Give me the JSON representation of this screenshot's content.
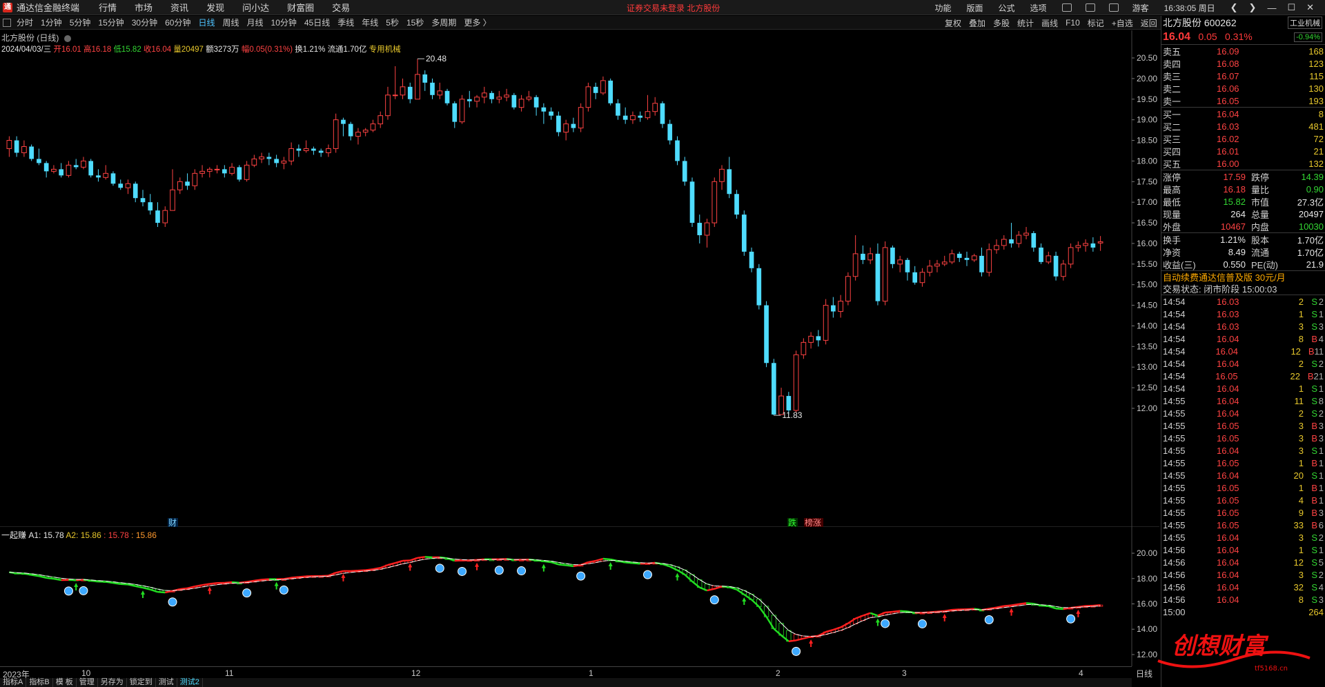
{
  "titlebar": {
    "app": "通达信金融终端",
    "menus": [
      "行情",
      "市场",
      "资讯",
      "发现",
      "问小达",
      "财富圈",
      "交易"
    ],
    "alert": "证券交易未登录  北方股份",
    "right_items": [
      "功能",
      "版面",
      "公式",
      "选项"
    ],
    "user": "游客",
    "time": "16:38:05 周日"
  },
  "periods": [
    "分时",
    "1分钟",
    "5分钟",
    "15分钟",
    "30分钟",
    "60分钟",
    "日线",
    "周线",
    "月线",
    "10分钟",
    "45日线",
    "季线",
    "年线",
    "5秒",
    "15秒",
    "多周期",
    "更多 〉"
  ],
  "active_period": "日线",
  "right_tools": [
    "复权",
    "叠加",
    "多股",
    "统计",
    "画线",
    "F10",
    "标记",
    "+自选",
    "返回"
  ],
  "chart_header": {
    "title": "北方股份 (日线)",
    "date": "2024/04/03/三",
    "open": "开16.01",
    "high": "高16.18",
    "low": "低15.82",
    "close": "收16.04",
    "volume": "量20497",
    "amount": "额3273万",
    "change": "幅0.05(0.31%)",
    "turnover": "换1.21%",
    "float_cap": "流通1.70亿",
    "sector": "专用机械"
  },
  "chart_data": {
    "type": "candlestick",
    "y_ticks": [
      "20.50",
      "20.00",
      "19.50",
      "19.00",
      "18.50",
      "18.00",
      "17.50",
      "17.00",
      "16.50",
      "16.00",
      "15.50",
      "15.00",
      "14.50",
      "14.00",
      "13.50",
      "13.00",
      "12.50",
      "12.00"
    ],
    "ylim": [
      11.75,
      20.75
    ],
    "high_marker": "20.48",
    "low_marker": "11.83",
    "candles": [
      [
        18.3,
        18.5,
        18.6,
        18.1
      ],
      [
        18.5,
        18.2,
        18.6,
        18.1
      ],
      [
        18.2,
        18.35,
        18.5,
        18.1
      ],
      [
        18.35,
        18.05,
        18.4,
        18.0
      ],
      [
        18.05,
        17.95,
        18.3,
        17.9
      ],
      [
        17.95,
        17.75,
        18.0,
        17.6
      ],
      [
        17.75,
        17.8,
        17.9,
        17.7
      ],
      [
        17.8,
        17.65,
        17.95,
        17.6
      ],
      [
        17.65,
        17.9,
        18.0,
        17.6
      ],
      [
        17.9,
        17.85,
        18.05,
        17.8
      ],
      [
        17.85,
        18.0,
        18.1,
        17.8
      ],
      [
        18.0,
        17.65,
        18.05,
        17.6
      ],
      [
        17.65,
        17.6,
        17.8,
        17.5
      ],
      [
        17.6,
        17.7,
        17.9,
        17.55
      ],
      [
        17.7,
        17.45,
        17.75,
        17.4
      ],
      [
        17.45,
        17.35,
        17.55,
        17.3
      ],
      [
        17.35,
        17.45,
        17.55,
        17.2
      ],
      [
        17.45,
        17.1,
        17.5,
        17.0
      ],
      [
        17.1,
        17.0,
        17.3,
        16.9
      ],
      [
        17.0,
        16.8,
        17.2,
        16.7
      ],
      [
        16.8,
        16.5,
        17.0,
        16.4
      ],
      [
        16.5,
        16.8,
        16.9,
        16.4
      ],
      [
        16.8,
        17.3,
        17.8,
        16.8
      ],
      [
        17.3,
        17.5,
        17.6,
        17.2
      ],
      [
        17.5,
        17.4,
        17.7,
        17.3
      ],
      [
        17.4,
        17.7,
        17.8,
        17.3
      ],
      [
        17.7,
        17.75,
        17.9,
        17.6
      ],
      [
        17.75,
        17.8,
        17.85,
        17.6
      ],
      [
        17.8,
        17.8,
        17.9,
        17.7
      ],
      [
        17.8,
        17.7,
        17.9,
        17.6
      ],
      [
        17.7,
        17.85,
        17.95,
        17.65
      ],
      [
        17.85,
        17.55,
        17.9,
        17.5
      ],
      [
        17.55,
        17.9,
        18.0,
        17.5
      ],
      [
        17.9,
        18.05,
        18.15,
        17.85
      ],
      [
        18.05,
        18.1,
        18.2,
        17.95
      ],
      [
        18.1,
        18.05,
        18.2,
        17.9
      ],
      [
        18.05,
        17.95,
        18.15,
        17.85
      ],
      [
        17.95,
        18.0,
        18.1,
        17.8
      ],
      [
        18.0,
        18.3,
        18.45,
        17.9
      ],
      [
        18.3,
        18.25,
        18.4,
        18.1
      ],
      [
        18.25,
        18.3,
        18.5,
        18.2
      ],
      [
        18.3,
        18.25,
        18.35,
        18.15
      ],
      [
        18.25,
        18.2,
        18.3,
        18.1
      ],
      [
        18.2,
        18.3,
        18.4,
        18.1
      ],
      [
        18.3,
        19.0,
        19.15,
        18.2
      ],
      [
        19.0,
        18.9,
        19.05,
        18.6
      ],
      [
        18.9,
        18.6,
        18.95,
        18.5
      ],
      [
        18.6,
        18.7,
        18.8,
        18.4
      ],
      [
        18.7,
        18.75,
        18.8,
        18.6
      ],
      [
        18.75,
        18.9,
        19.0,
        18.7
      ],
      [
        18.9,
        19.1,
        19.2,
        18.8
      ],
      [
        19.1,
        19.6,
        19.8,
        19.0
      ],
      [
        19.6,
        19.6,
        20.3,
        19.5
      ],
      [
        19.6,
        19.8,
        20.0,
        19.5
      ],
      [
        19.8,
        19.5,
        19.9,
        19.4
      ],
      [
        19.5,
        20.1,
        20.48,
        19.5
      ],
      [
        20.1,
        19.9,
        20.2,
        19.7
      ],
      [
        19.9,
        19.6,
        20.0,
        19.5
      ],
      [
        19.6,
        19.7,
        19.9,
        19.5
      ],
      [
        19.7,
        19.4,
        19.75,
        19.35
      ],
      [
        19.4,
        18.95,
        19.45,
        18.8
      ],
      [
        18.95,
        19.5,
        19.6,
        18.9
      ],
      [
        19.5,
        19.45,
        19.7,
        19.3
      ],
      [
        19.45,
        19.55,
        19.6,
        19.3
      ],
      [
        19.55,
        19.65,
        19.8,
        19.4
      ],
      [
        19.65,
        19.5,
        19.7,
        19.4
      ],
      [
        19.5,
        19.55,
        19.7,
        19.4
      ],
      [
        19.55,
        19.6,
        19.75,
        19.45
      ],
      [
        19.6,
        19.3,
        19.65,
        19.25
      ],
      [
        19.3,
        19.5,
        19.6,
        19.2
      ],
      [
        19.5,
        19.55,
        19.7,
        19.45
      ],
      [
        19.55,
        19.3,
        19.6,
        19.1
      ],
      [
        19.3,
        19.2,
        19.4,
        18.9
      ],
      [
        19.2,
        19.1,
        19.3,
        19.0
      ],
      [
        19.1,
        18.7,
        19.2,
        18.6
      ],
      [
        18.7,
        18.9,
        19.0,
        18.5
      ],
      [
        18.9,
        18.8,
        19.05,
        18.7
      ],
      [
        18.8,
        19.3,
        19.4,
        18.7
      ],
      [
        19.3,
        19.8,
        19.9,
        19.2
      ],
      [
        19.8,
        19.65,
        19.9,
        19.5
      ],
      [
        19.65,
        19.95,
        20.05,
        19.6
      ],
      [
        19.95,
        19.4,
        20.0,
        19.35
      ],
      [
        19.4,
        19.1,
        19.5,
        19.0
      ],
      [
        19.1,
        19.0,
        19.3,
        18.9
      ],
      [
        19.0,
        19.1,
        19.2,
        18.9
      ],
      [
        19.1,
        19.05,
        19.2,
        18.95
      ],
      [
        19.05,
        19.2,
        19.6,
        19.0
      ],
      [
        19.2,
        19.4,
        19.55,
        19.1
      ],
      [
        19.4,
        18.9,
        19.45,
        18.8
      ],
      [
        18.9,
        18.5,
        19.0,
        18.4
      ],
      [
        18.5,
        18.0,
        18.6,
        17.9
      ],
      [
        18.0,
        17.5,
        18.1,
        17.4
      ],
      [
        17.5,
        16.5,
        17.6,
        16.4
      ],
      [
        16.5,
        16.2,
        16.7,
        16.0
      ],
      [
        16.2,
        16.5,
        16.6,
        15.9
      ],
      [
        16.5,
        17.5,
        17.6,
        16.4
      ],
      [
        17.5,
        17.8,
        17.9,
        17.3
      ],
      [
        17.8,
        17.2,
        18.1,
        17.1
      ],
      [
        17.2,
        16.7,
        17.3,
        16.6
      ],
      [
        16.7,
        15.8,
        16.8,
        15.7
      ],
      [
        15.8,
        15.4,
        15.9,
        15.3
      ],
      [
        15.4,
        14.5,
        15.5,
        14.4
      ],
      [
        14.5,
        13.1,
        14.6,
        13.0
      ],
      [
        13.1,
        11.85,
        13.2,
        11.83
      ],
      [
        11.85,
        12.3,
        12.5,
        11.9
      ],
      [
        12.3,
        11.95,
        12.4,
        11.85
      ],
      [
        11.95,
        13.3,
        13.4,
        11.9
      ],
      [
        13.3,
        13.6,
        13.7,
        13.2
      ],
      [
        13.6,
        13.75,
        13.85,
        13.45
      ],
      [
        13.75,
        13.65,
        13.9,
        13.5
      ],
      [
        13.65,
        14.5,
        14.65,
        13.55
      ],
      [
        14.5,
        14.35,
        14.7,
        14.2
      ],
      [
        14.35,
        14.6,
        14.75,
        14.2
      ],
      [
        14.6,
        15.2,
        15.3,
        14.5
      ],
      [
        15.2,
        15.75,
        16.2,
        15.1
      ],
      [
        15.75,
        15.6,
        15.95,
        15.5
      ],
      [
        15.6,
        15.75,
        15.9,
        15.5
      ],
      [
        15.75,
        14.6,
        16.0,
        14.5
      ],
      [
        14.6,
        15.9,
        16.05,
        14.5
      ],
      [
        15.9,
        15.5,
        15.95,
        15.4
      ],
      [
        15.5,
        15.6,
        15.7,
        15.3
      ],
      [
        15.6,
        15.3,
        15.65,
        15.1
      ],
      [
        15.3,
        15.05,
        15.45,
        15.0
      ],
      [
        15.05,
        15.3,
        15.4,
        14.95
      ],
      [
        15.3,
        15.45,
        15.6,
        15.2
      ],
      [
        15.45,
        15.5,
        15.6,
        15.3
      ],
      [
        15.5,
        15.55,
        15.7,
        15.45
      ],
      [
        15.55,
        15.75,
        15.85,
        15.5
      ],
      [
        15.75,
        15.65,
        15.8,
        15.55
      ],
      [
        15.65,
        15.6,
        15.8,
        15.45
      ],
      [
        15.6,
        15.7,
        15.75,
        15.55
      ],
      [
        15.7,
        15.3,
        15.9,
        15.2
      ],
      [
        15.3,
        15.85,
        16.0,
        15.2
      ],
      [
        15.85,
        15.95,
        16.1,
        15.75
      ],
      [
        15.95,
        16.1,
        16.2,
        15.85
      ],
      [
        16.1,
        16.0,
        16.5,
        15.9
      ],
      [
        16.0,
        16.2,
        16.3,
        15.9
      ],
      [
        16.2,
        16.25,
        16.4,
        16.1
      ],
      [
        16.25,
        15.9,
        16.3,
        15.8
      ],
      [
        15.9,
        15.55,
        16.0,
        15.5
      ],
      [
        15.55,
        15.7,
        15.8,
        15.5
      ],
      [
        15.7,
        15.2,
        15.8,
        15.1
      ],
      [
        15.2,
        15.5,
        15.6,
        15.1
      ],
      [
        15.5,
        15.9,
        16.0,
        15.4
      ],
      [
        15.9,
        15.95,
        16.05,
        15.8
      ],
      [
        15.95,
        16.0,
        16.1,
        15.8
      ],
      [
        16.0,
        15.9,
        16.15,
        15.8
      ],
      [
        16.01,
        16.04,
        16.18,
        15.82
      ]
    ],
    "markers": {
      "cai": "财",
      "die": "跌",
      "bang": "榜涨"
    }
  },
  "indicator": {
    "name": "一起赚",
    "a1": "A1: 15.78",
    "a2": "A2: 15.86",
    "a3": ": 15.78",
    "a4": ": 15.86",
    "y_ticks": [
      "20.00",
      "18.00",
      "16.00",
      "14.00",
      "12.00"
    ],
    "ylim": [
      11.3,
      21.5
    ]
  },
  "xaxis": [
    "2023年",
    "10",
    "11",
    "12",
    "1",
    "2",
    "3",
    "4"
  ],
  "bottom_tabs": [
    "指标A",
    "指标B",
    "模 板",
    "管理",
    "另存为",
    "锁定到",
    "测试",
    "测试2"
  ],
  "active_tab": "测试2",
  "day_button": "日线",
  "quote": {
    "name": "北方股份  600262",
    "industry": "工业机械",
    "price": "16.04",
    "change": "0.05",
    "pct": "0.31%",
    "industry_pct": "-0.94%",
    "asks": [
      {
        "label": "卖五",
        "price": "16.09",
        "vol": "168"
      },
      {
        "label": "卖四",
        "price": "16.08",
        "vol": "123"
      },
      {
        "label": "卖三",
        "price": "16.07",
        "vol": "115"
      },
      {
        "label": "卖二",
        "price": "16.06",
        "vol": "130"
      },
      {
        "label": "卖一",
        "price": "16.05",
        "vol": "193"
      }
    ],
    "bids": [
      {
        "label": "买一",
        "price": "16.04",
        "vol": "8"
      },
      {
        "label": "买二",
        "price": "16.03",
        "vol": "481"
      },
      {
        "label": "买三",
        "price": "16.02",
        "vol": "72"
      },
      {
        "label": "买四",
        "price": "16.01",
        "vol": "21"
      },
      {
        "label": "买五",
        "price": "16.00",
        "vol": "132"
      }
    ],
    "stats1": [
      {
        "a": "涨停",
        "av": "17.59",
        "ac": "red",
        "b": "跌停",
        "bv": "14.39",
        "bc": "green"
      },
      {
        "a": "最高",
        "av": "16.18",
        "ac": "red",
        "b": "量比",
        "bv": "0.90",
        "bc": "green"
      },
      {
        "a": "最低",
        "av": "15.82",
        "ac": "green",
        "b": "市值",
        "bv": "27.3亿",
        "bc": "white"
      },
      {
        "a": "现量",
        "av": "264",
        "ac": "white",
        "b": "总量",
        "bv": "20497",
        "bc": "white"
      },
      {
        "a": "外盘",
        "av": "10467",
        "ac": "red",
        "b": "内盘",
        "bv": "10030",
        "bc": "green"
      }
    ],
    "stats2": [
      {
        "a": "换手",
        "av": "1.21%",
        "ac": "white",
        "b": "股本",
        "bv": "1.70亿",
        "bc": "white"
      },
      {
        "a": "净资",
        "av": "8.49",
        "ac": "white",
        "b": "流通",
        "bv": "1.70亿",
        "bc": "white"
      },
      {
        "a": "收益(三)",
        "av": "0.550",
        "ac": "white",
        "b": "PE(动)",
        "bv": "21.9",
        "bc": "white"
      }
    ],
    "promo": "自动续费通达信普及版  30元/月",
    "trade_status": "交易状态: 闭市阶段 15:00:03",
    "ticks": [
      [
        "14:54",
        "16.03",
        "2",
        "S",
        "2"
      ],
      [
        "14:54",
        "16.03",
        "1",
        "S",
        "1"
      ],
      [
        "14:54",
        "16.03",
        "3",
        "S",
        "3"
      ],
      [
        "14:54",
        "16.04",
        "8",
        "B",
        "4"
      ],
      [
        "14:54",
        "16.04",
        "12",
        "B",
        "11"
      ],
      [
        "14:54",
        "16.04",
        "2",
        "S",
        "2"
      ],
      [
        "14:54",
        "16.05",
        "22",
        "B",
        "21"
      ],
      [
        "14:54",
        "16.04",
        "1",
        "S",
        "1"
      ],
      [
        "14:55",
        "16.04",
        "11",
        "S",
        "8"
      ],
      [
        "14:55",
        "16.04",
        "2",
        "S",
        "2"
      ],
      [
        "14:55",
        "16.05",
        "3",
        "B",
        "3"
      ],
      [
        "14:55",
        "16.05",
        "3",
        "B",
        "3"
      ],
      [
        "14:55",
        "16.04",
        "3",
        "S",
        "1"
      ],
      [
        "14:55",
        "16.05",
        "1",
        "B",
        "1"
      ],
      [
        "14:55",
        "16.04",
        "20",
        "S",
        "1"
      ],
      [
        "14:55",
        "16.05",
        "1",
        "B",
        "1"
      ],
      [
        "14:55",
        "16.05",
        "4",
        "B",
        "1"
      ],
      [
        "14:55",
        "16.05",
        "9",
        "B",
        "3"
      ],
      [
        "14:55",
        "16.05",
        "33",
        "B",
        "6"
      ],
      [
        "14:55",
        "16.04",
        "3",
        "S",
        "2"
      ],
      [
        "14:56",
        "16.04",
        "1",
        "S",
        "1"
      ],
      [
        "14:56",
        "16.04",
        "12",
        "S",
        "5"
      ],
      [
        "14:56",
        "16.04",
        "3",
        "S",
        "2"
      ],
      [
        "14:56",
        "16.04",
        "32",
        "S",
        "4"
      ],
      [
        "14:56",
        "16.04",
        "8",
        "S",
        "3"
      ]
    ],
    "close_tick": [
      "15:00",
      "264"
    ]
  },
  "watermark": {
    "text": "创想财富",
    "site": "tf5168.cn"
  },
  "colors": {
    "up": "#ff4343",
    "down": "#4fdcff",
    "ind_up": "#ff2020",
    "ind_down": "#22dd22"
  }
}
